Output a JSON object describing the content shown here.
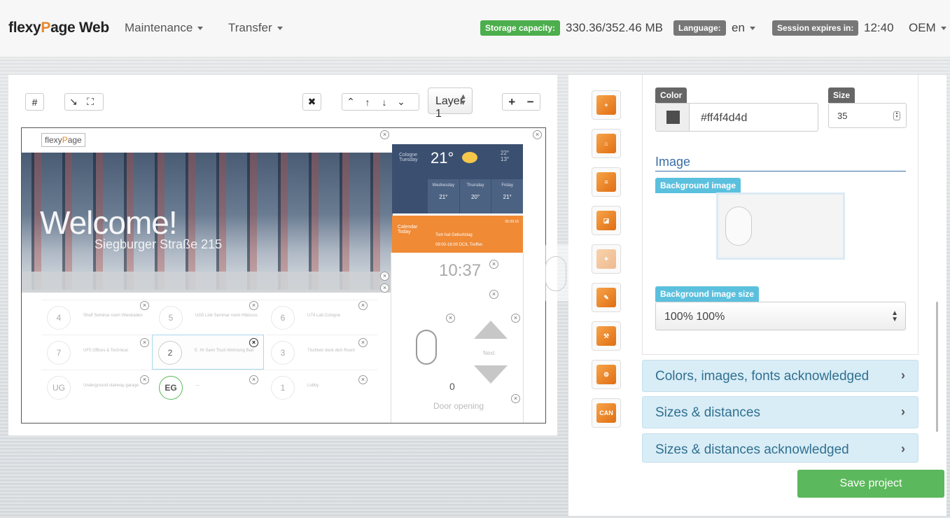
{
  "topbar": {
    "brand_prefix": "flexy",
    "brand_p": "P",
    "brand_suffix": "age Web",
    "menu_maintenance": "Maintenance",
    "menu_transfer": "Transfer",
    "storage_label": "Storage capacity:",
    "storage_value": "330.36/352.46 MB",
    "language_label": "Language:",
    "language_value": "en",
    "session_label": "Session expires in:",
    "session_value": "12:40",
    "oem_label": "OEM"
  },
  "toolbar": {
    "grid_icon": "#",
    "shrink_icon": "↘",
    "expand_icon": "⛶",
    "delete_icon": "✖",
    "up_chevron": "⌃",
    "up_arrow": "↑",
    "down_arrow": "↓",
    "down_chevron": "⌄",
    "layer_value": "Layer 1",
    "add_icon": "+",
    "remove_icon": "−"
  },
  "preview": {
    "logo_prefix": "flexy",
    "logo_p": "P",
    "logo_suffix": "age",
    "welcome": "Welcome!",
    "street": "Siegburger Straße 215",
    "weather": {
      "city": "Cologne",
      "city_day": "Tuesday",
      "temp": "21°",
      "high": "22°",
      "low": "13°",
      "days": [
        {
          "name": "Wednesday",
          "temp": "21°"
        },
        {
          "name": "Thursday",
          "temp": "20°"
        },
        {
          "name": "Friday",
          "temp": "21°"
        }
      ]
    },
    "calendar": {
      "title": "Calendar",
      "subtitle": "Today",
      "event": "Tom hat Geburtstag",
      "time": "09:00-16:00   DCIL Treffen",
      "date": "05.09.16"
    },
    "clock": "10:37",
    "next": "Next",
    "count": "0",
    "door": "Door opening",
    "cells": [
      {
        "num": "4",
        "label": "Shelf Seminar room Wiesbaden"
      },
      {
        "num": "5",
        "label": "UG5 Link Seminar room Hibiscus"
      },
      {
        "num": "6",
        "label": "UT4 Lab Cologne"
      },
      {
        "num": "7",
        "label": "UF5 Offices & Technical"
      },
      {
        "num": "2",
        "label": "E. Hr Sami Tisch Wohnung Bad"
      },
      {
        "num": "3",
        "label": "Tischlein deck dich Room"
      },
      {
        "num": "UG",
        "label": "Underground stairway garage"
      },
      {
        "num": "EG",
        "label": "---"
      },
      {
        "num": "1",
        "label": "Lobby"
      }
    ]
  },
  "props": {
    "color_label": "Color",
    "color_value": "#ff4f4d4d",
    "size_label": "Size",
    "size_value": "35",
    "image_title": "Image",
    "bg_image_label": "Background image",
    "bg_size_label": "Background image size",
    "bg_size_value": "100% 100%"
  },
  "tools": [
    "add-widget",
    "home",
    "news",
    "note",
    "light",
    "edit",
    "settings",
    "gear",
    "CAN"
  ],
  "accordion": [
    "Colors, images, fonts acknowledged",
    "Sizes & distances",
    "Sizes & distances acknowledged"
  ],
  "save_label": "Save project",
  "colors": {
    "accent": "#e8872a",
    "green": "#5cb85c",
    "blue": "#5bc0de"
  }
}
